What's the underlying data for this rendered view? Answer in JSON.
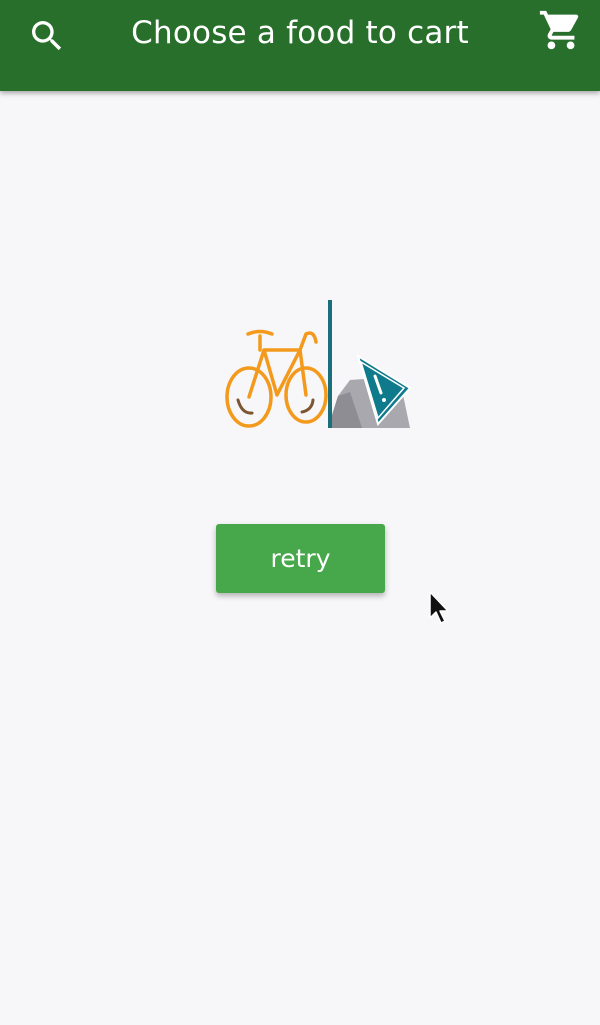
{
  "app_bar": {
    "title": "Choose a food to cart",
    "search_icon": "search-icon",
    "cart_icon": "shopping-cart-icon",
    "background_color": "#276f2b"
  },
  "error_state": {
    "illustration": "broken-bicycle-warning-illustration",
    "retry_label": "retry",
    "button_color": "#46a84a"
  }
}
